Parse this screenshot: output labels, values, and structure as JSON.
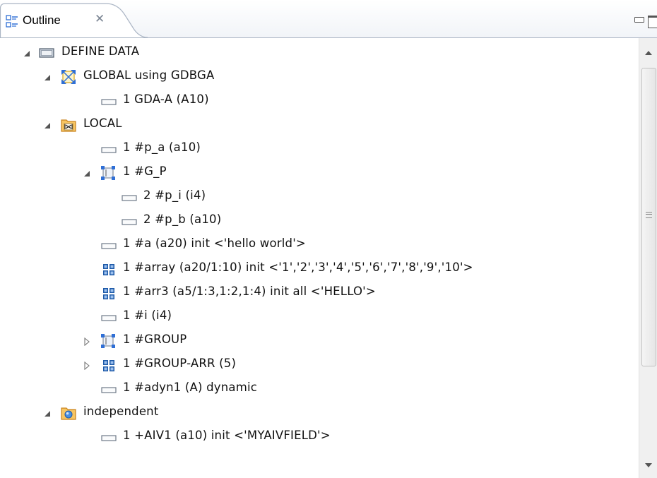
{
  "view": {
    "tab_label": "Outline",
    "tab_icon": "outline-icon",
    "close_glyph": "✕"
  },
  "colors": {
    "tab_border": "#aab5c4",
    "gda_icon": "#2f6fd6",
    "folder_icon": "#e8a33a",
    "field_icon_border": "#6f7a88",
    "array_icon": "#1e5aa8"
  },
  "tree": {
    "rows": [
      {
        "label": "DEFINE DATA",
        "icon": "define-data-icon",
        "twisty": "expanded"
      },
      {
        "label": "GLOBAL using GDBGA",
        "icon": "global-data-area-icon",
        "twisty": "expanded"
      },
      {
        "label": "1 GDA-A (A10)",
        "icon": "field-icon",
        "twisty": "none"
      },
      {
        "label": "LOCAL",
        "icon": "local-data-folder-icon",
        "twisty": "expanded"
      },
      {
        "label": "1 #p_a (a10)",
        "icon": "field-icon",
        "twisty": "none"
      },
      {
        "label": "1 #G_P",
        "icon": "group-icon",
        "twisty": "expanded"
      },
      {
        "label": "2 #p_i (i4)",
        "icon": "field-icon",
        "twisty": "none"
      },
      {
        "label": "2 #p_b (a10)",
        "icon": "field-icon",
        "twisty": "none"
      },
      {
        "label": "1 #a (a20) init <'hello world'>",
        "icon": "field-icon",
        "twisty": "none"
      },
      {
        "label": "1 #array (a20/1:10) init <'1','2','3','4','5','6','7','8','9','10'>",
        "icon": "array-icon",
        "twisty": "none"
      },
      {
        "label": "1 #arr3 (a5/1:3,1:2,1:4) init all <'HELLO'>",
        "icon": "array-icon",
        "twisty": "none"
      },
      {
        "label": "1 #i (i4)",
        "icon": "field-icon",
        "twisty": "none"
      },
      {
        "label": "1 #GROUP",
        "icon": "group-icon",
        "twisty": "collapsed"
      },
      {
        "label": "1 #GROUP-ARR (5)",
        "icon": "array-icon",
        "twisty": "collapsed"
      },
      {
        "label": "1 #adyn1 (A) dynamic",
        "icon": "field-icon",
        "twisty": "none"
      },
      {
        "label": "independent",
        "icon": "independent-folder-icon",
        "twisty": "expanded"
      },
      {
        "label": "1 +AIV1 (a10) init <'MYAIVFIELD'>",
        "icon": "field-icon",
        "twisty": "none"
      }
    ]
  }
}
